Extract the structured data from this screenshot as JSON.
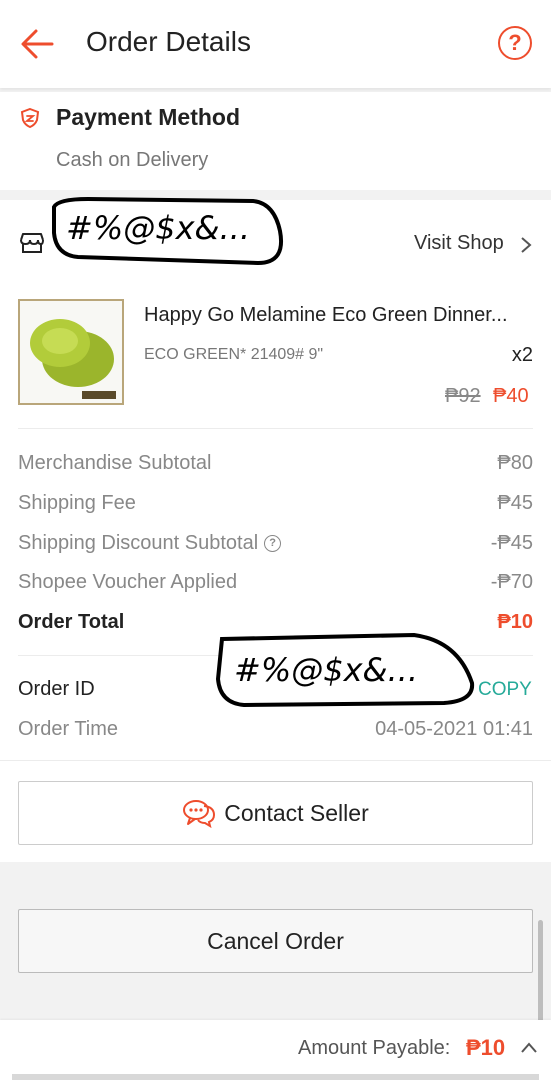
{
  "header": {
    "title": "Order Details",
    "help_glyph": "?"
  },
  "payment": {
    "title": "Payment Method",
    "value": "Cash on Delivery"
  },
  "shop": {
    "name_redacted": "#%@$x&...",
    "visit_label": "Visit Shop"
  },
  "product": {
    "name": "Happy Go Melamine Eco Green Dinner...",
    "variation": "ECO GREEN* 21409# 9\"",
    "quantity": "x2",
    "original_price": "₱92",
    "price": "₱40"
  },
  "summary": [
    {
      "label": "Merchandise Subtotal",
      "value": "₱80"
    },
    {
      "label": "Shipping Fee",
      "value": "₱45"
    },
    {
      "label": "Shipping Discount Subtotal",
      "value": "-₱45"
    },
    {
      "label": "Shopee Voucher Applied",
      "value": "-₱70"
    }
  ],
  "order_total": {
    "label": "Order Total",
    "value": "₱10"
  },
  "order_id": {
    "label": "Order ID",
    "value_redacted": "#%@$x&...",
    "copy_label": "COPY"
  },
  "order_time": {
    "label": "Order Time",
    "value": "04-05-2021 01:41"
  },
  "actions": {
    "contact_seller": "Contact Seller",
    "cancel_order": "Cancel Order"
  },
  "footer": {
    "amount_label": "Amount Payable:",
    "amount_value": "₱10"
  },
  "colors": {
    "accent": "#ee4d2d",
    "teal": "#26aa99",
    "product_green": "#a4c234"
  }
}
